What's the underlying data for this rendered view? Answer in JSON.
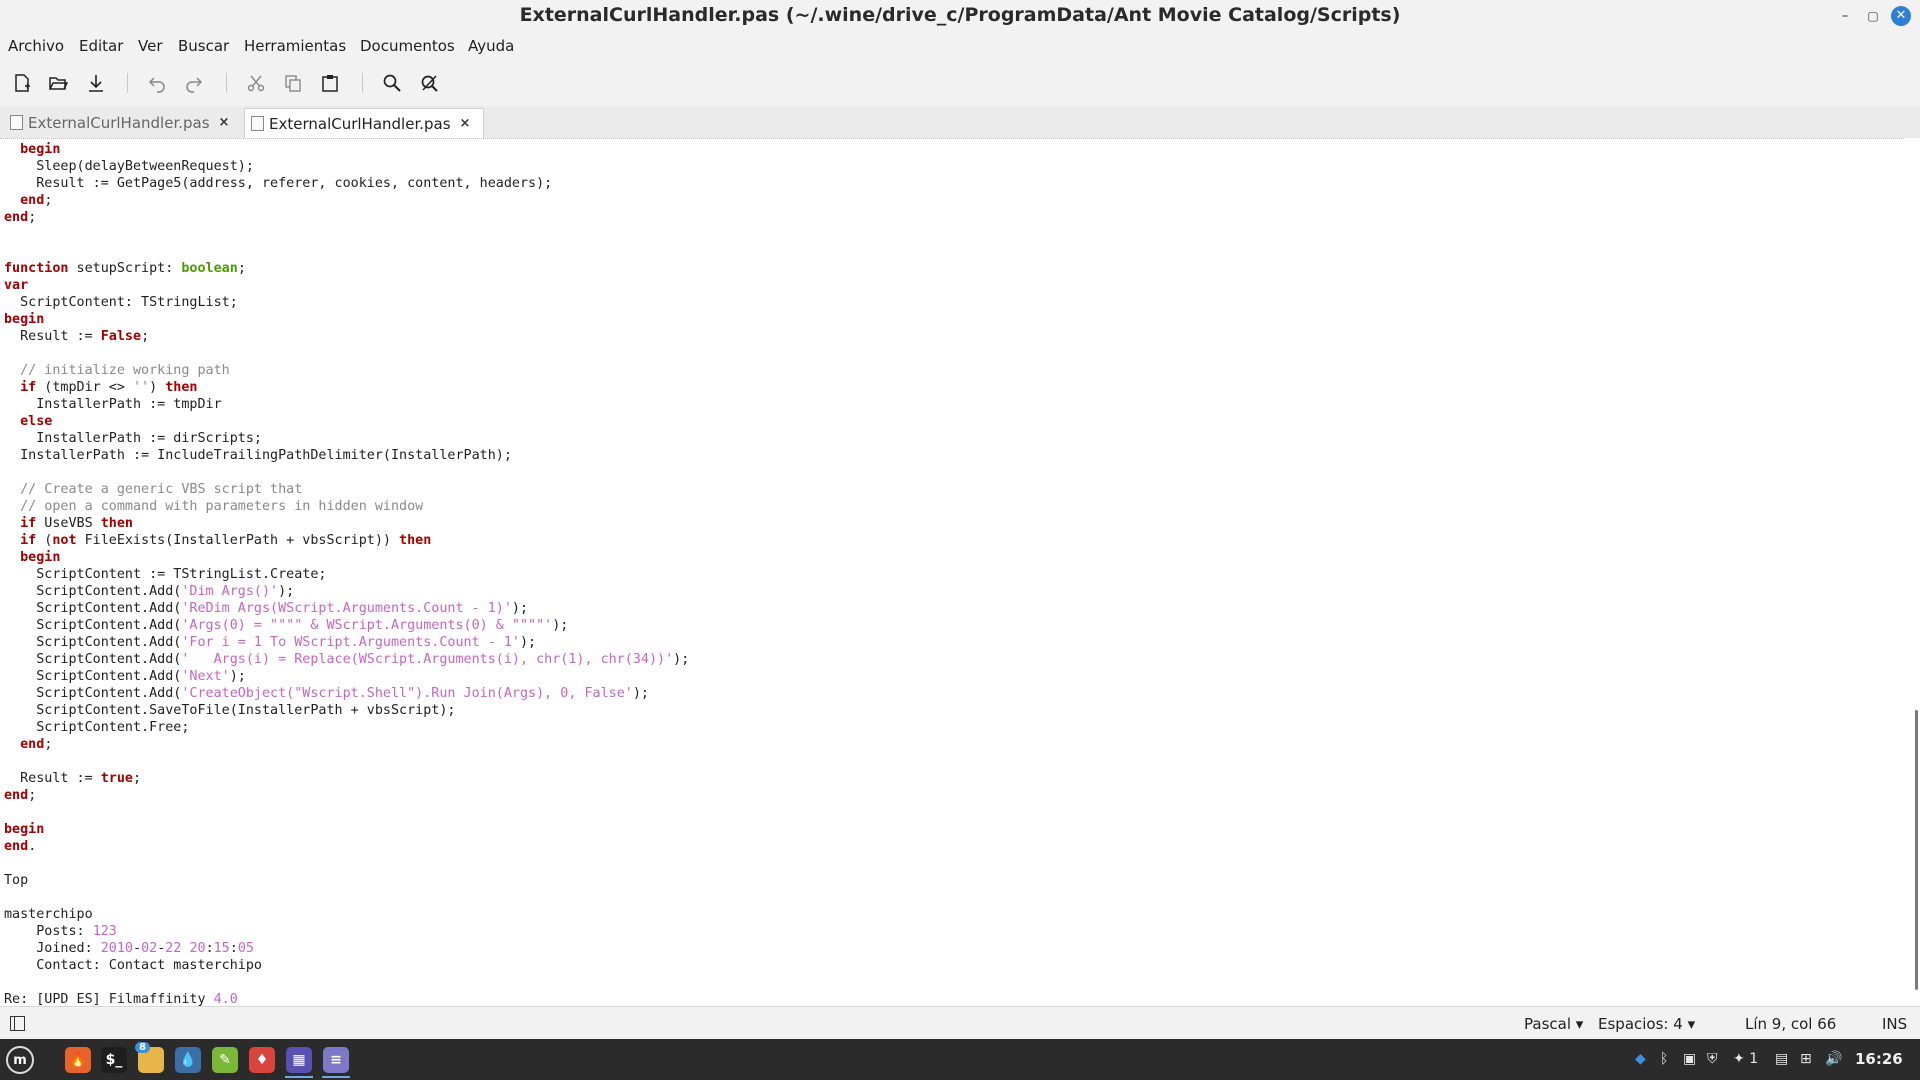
{
  "window": {
    "title": "ExternalCurlHandler.pas (~/.wine/drive_c/ProgramData/Ant Movie Catalog/Scripts)",
    "minimize_glyph": "–",
    "maximize_glyph": "▢",
    "close_glyph": "✕"
  },
  "menubar": {
    "items": [
      "Archivo",
      "Editar",
      "Ver",
      "Buscar",
      "Herramientas",
      "Documentos",
      "Ayuda"
    ]
  },
  "toolbar": {
    "icons": [
      "new-document-icon",
      "open-icon",
      "save-download-icon",
      "undo-icon",
      "redo-icon",
      "cut-icon",
      "copy-icon",
      "paste-icon",
      "search-icon",
      "search-replace-icon"
    ]
  },
  "tabs": [
    {
      "label": "ExternalCurlHandler.pas",
      "close": "×",
      "active": false
    },
    {
      "label": "ExternalCurlHandler.pas",
      "close": "×",
      "active": true
    }
  ],
  "editor": {
    "lines": [
      [
        {
          "t": "  "
        },
        {
          "t": "begin",
          "c": "kw"
        }
      ],
      [
        {
          "t": "    Sleep(delayBetweenRequest);"
        }
      ],
      [
        {
          "t": "    Result := GetPage5(address, referer, cookies, content, headers);"
        }
      ],
      [
        {
          "t": "  "
        },
        {
          "t": "end",
          "c": "kw"
        },
        {
          "t": ";"
        }
      ],
      [
        {
          "t": "end",
          "c": "kw"
        },
        {
          "t": ";"
        }
      ],
      [],
      [],
      [
        {
          "t": "function",
          "c": "kw"
        },
        {
          "t": " setupScript: "
        },
        {
          "t": "boolean",
          "c": "ty"
        },
        {
          "t": ";"
        }
      ],
      [
        {
          "t": "var",
          "c": "kw"
        }
      ],
      [
        {
          "t": "  ScriptContent: TStringList;"
        }
      ],
      [
        {
          "t": "begin",
          "c": "kw"
        }
      ],
      [
        {
          "t": "  Result := "
        },
        {
          "t": "False",
          "c": "kw"
        },
        {
          "t": ";"
        }
      ],
      [],
      [
        {
          "t": "  // initialize working path",
          "c": "cm"
        }
      ],
      [
        {
          "t": "  "
        },
        {
          "t": "if",
          "c": "kw"
        },
        {
          "t": " (tmpDir <> "
        },
        {
          "t": "''",
          "c": "st"
        },
        {
          "t": ") "
        },
        {
          "t": "then",
          "c": "kw"
        }
      ],
      [
        {
          "t": "    InstallerPath := tmpDir"
        }
      ],
      [
        {
          "t": "  "
        },
        {
          "t": "else",
          "c": "kw"
        }
      ],
      [
        {
          "t": "    InstallerPath := dirScripts;"
        }
      ],
      [
        {
          "t": "  InstallerPath := IncludeTrailingPathDelimiter(InstallerPath);"
        }
      ],
      [],
      [
        {
          "t": "  // Create a generic VBS script that",
          "c": "cm"
        }
      ],
      [
        {
          "t": "  // open a command with parameters in hidden window",
          "c": "cm"
        }
      ],
      [
        {
          "t": "  "
        },
        {
          "t": "if",
          "c": "kw"
        },
        {
          "t": " UseVBS "
        },
        {
          "t": "then",
          "c": "kw"
        }
      ],
      [
        {
          "t": "  "
        },
        {
          "t": "if",
          "c": "kw"
        },
        {
          "t": " ("
        },
        {
          "t": "not",
          "c": "kw"
        },
        {
          "t": " FileExists(InstallerPath + vbsScript)) "
        },
        {
          "t": "then",
          "c": "kw"
        }
      ],
      [
        {
          "t": "  "
        },
        {
          "t": "begin",
          "c": "kw"
        }
      ],
      [
        {
          "t": "    ScriptContent := TStringList.Create;"
        }
      ],
      [
        {
          "t": "    ScriptContent.Add("
        },
        {
          "t": "'Dim Args()'",
          "c": "st"
        },
        {
          "t": ");"
        }
      ],
      [
        {
          "t": "    ScriptContent.Add("
        },
        {
          "t": "'ReDim Args(WScript.Arguments.Count - 1)'",
          "c": "st"
        },
        {
          "t": ");"
        }
      ],
      [
        {
          "t": "    ScriptContent.Add("
        },
        {
          "t": "'Args(0) = \"\"\"\" & WScript.Arguments(0) & \"\"\"\"'",
          "c": "st"
        },
        {
          "t": ");"
        }
      ],
      [
        {
          "t": "    ScriptContent.Add("
        },
        {
          "t": "'For i = 1 To WScript.Arguments.Count - 1'",
          "c": "st"
        },
        {
          "t": ");"
        }
      ],
      [
        {
          "t": "    ScriptContent.Add("
        },
        {
          "t": "'   Args(i) = Replace(WScript.Arguments(i), chr(1), chr(34))'",
          "c": "st"
        },
        {
          "t": ");"
        }
      ],
      [
        {
          "t": "    ScriptContent.Add("
        },
        {
          "t": "'Next'",
          "c": "st"
        },
        {
          "t": ");"
        }
      ],
      [
        {
          "t": "    ScriptContent.Add("
        },
        {
          "t": "'CreateObject(\"Wscript.Shell\").Run Join(Args), 0, False'",
          "c": "st"
        },
        {
          "t": ");"
        }
      ],
      [
        {
          "t": "    ScriptContent.SaveToFile(InstallerPath + vbsScript);"
        }
      ],
      [
        {
          "t": "    ScriptContent.Free;"
        }
      ],
      [
        {
          "t": "  "
        },
        {
          "t": "end",
          "c": "kw"
        },
        {
          "t": ";"
        }
      ],
      [],
      [
        {
          "t": "  Result := "
        },
        {
          "t": "true",
          "c": "kw"
        },
        {
          "t": ";"
        }
      ],
      [
        {
          "t": "end",
          "c": "kw"
        },
        {
          "t": ";"
        }
      ],
      [],
      [
        {
          "t": "begin",
          "c": "kw"
        }
      ],
      [
        {
          "t": "end",
          "c": "kw"
        },
        {
          "t": "."
        }
      ],
      [],
      [
        {
          "t": "Top"
        }
      ],
      [],
      [
        {
          "t": "masterchipo"
        }
      ],
      [
        {
          "t": "    Posts: "
        },
        {
          "t": "123",
          "c": "nm"
        }
      ],
      [
        {
          "t": "    Joined: "
        },
        {
          "t": "2010",
          "c": "nm"
        },
        {
          "t": "-"
        },
        {
          "t": "02",
          "c": "nm"
        },
        {
          "t": "-"
        },
        {
          "t": "22",
          "c": "nm"
        },
        {
          "t": " "
        },
        {
          "t": "20",
          "c": "nm"
        },
        {
          "t": ":"
        },
        {
          "t": "15",
          "c": "nm"
        },
        {
          "t": ":"
        },
        {
          "t": "05",
          "c": "nm"
        }
      ],
      [
        {
          "t": "    Contact: Contact masterchipo"
        }
      ],
      [],
      [
        {
          "t": "Re: [UPD ES] Filmaffinity "
        },
        {
          "t": "4.0",
          "c": "nm"
        }
      ]
    ]
  },
  "statusbar": {
    "language": "Pascal",
    "indent": "Espacios: 4",
    "position": "Lín 9, col 66",
    "mode": "INS"
  },
  "taskbar": {
    "apps": [
      {
        "name": "firefox",
        "color": "#e8632b",
        "glyph": "🔥"
      },
      {
        "name": "terminal",
        "color": "#1e1e1e",
        "glyph": "$_"
      },
      {
        "name": "files",
        "color": "#e8b54a",
        "glyph": "",
        "badge": "8"
      },
      {
        "name": "drop",
        "color": "#3b6fa6",
        "glyph": "💧"
      },
      {
        "name": "pen",
        "color": "#7ab83a",
        "glyph": "✎"
      },
      {
        "name": "game",
        "color": "#d9453d",
        "glyph": "♦"
      },
      {
        "name": "video",
        "color": "#5a4fb3",
        "glyph": "▦"
      },
      {
        "name": "text-editor",
        "color": "#7d79c7",
        "glyph": "≡"
      }
    ],
    "tray": {
      "workspace": "1",
      "clock": "16:26"
    }
  }
}
